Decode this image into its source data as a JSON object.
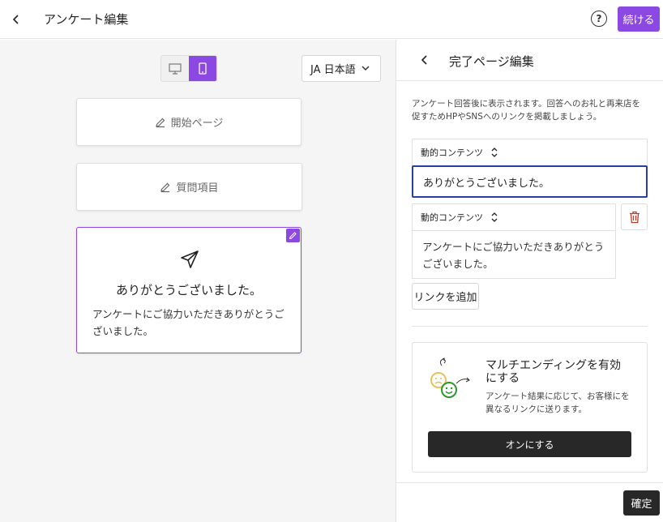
{
  "header": {
    "title": "アンケート編集",
    "help_label": "?",
    "continue_label": "続ける"
  },
  "left": {
    "language": "JA 日本語",
    "cards": {
      "start_label": "開始ページ",
      "questions_label": "質問項目",
      "done": {
        "heading": "ありがとうございました。",
        "body": "アンケートにご協力いただきありがとうございました。"
      }
    }
  },
  "right": {
    "title": "完了ページ編集",
    "description": "アンケート回答後に表示されます。回答へのお礼と再来店を促すためHPやSNSへのリンクを掲載しましょう。",
    "content_blocks": [
      {
        "label": "動的コンテンツ",
        "value": "ありがとうございました。"
      },
      {
        "label": "動的コンテンツ",
        "value": "アンケートにご協力いただきありがとうございました。"
      }
    ],
    "add_link_label": "リンクを追加",
    "multi_ending": {
      "title": "マルチエンディングを有効にする",
      "description": "アンケート結果に応じて、お客様にを異なるリンクに送ります。",
      "button_label": "オンにする"
    },
    "confirm_label": "確定"
  },
  "colors": {
    "accent": "#8b48e3",
    "focus_border": "#2b3ea6",
    "dark_button": "#282828",
    "danger": "#c0392b"
  }
}
